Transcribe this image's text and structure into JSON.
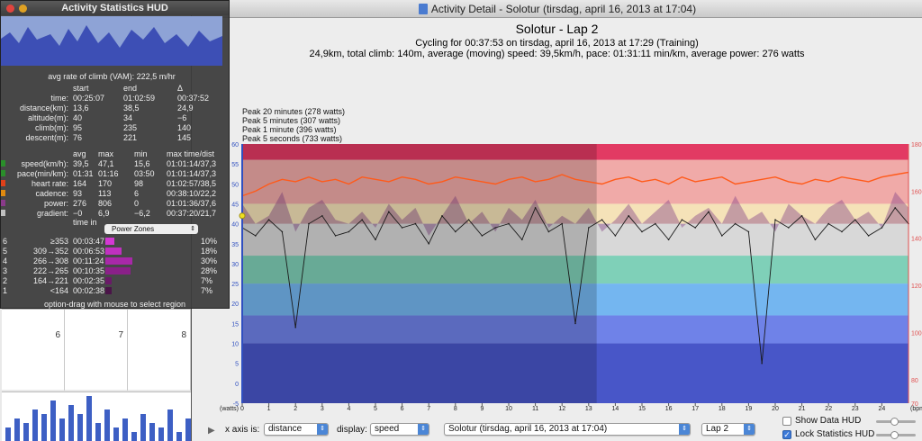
{
  "hud": {
    "title": "Activity Statistics HUD",
    "vam_label": "avg rate of climb (VAM):",
    "vam_value": "222,5 m/hr",
    "cols1": [
      "start",
      "end",
      "Δ"
    ],
    "rows1": [
      {
        "label": "time:",
        "v": [
          "00:25:07",
          "01:02:59",
          "00:37:52"
        ]
      },
      {
        "label": "distance(km):",
        "v": [
          "13,6",
          "38,5",
          "24,9"
        ]
      },
      {
        "label": "altitude(m):",
        "v": [
          "40",
          "34",
          "−6"
        ]
      },
      {
        "label": "climb(m):",
        "v": [
          "95",
          "235",
          "140"
        ]
      },
      {
        "label": "descent(m):",
        "v": [
          "76",
          "221",
          "145"
        ]
      }
    ],
    "cols2": [
      "avg",
      "max",
      "min",
      "max time/dist"
    ],
    "rows2": [
      {
        "label": "speed(km/h):",
        "color": "#2a8f2a",
        "v": [
          "39,5",
          "47,1",
          "15,6",
          "01:01:14/37,3"
        ]
      },
      {
        "label": "pace(min/km):",
        "color": "#2a8f2a",
        "v": [
          "01:31",
          "01:16",
          "03:50",
          "01:01:14/37,3"
        ]
      },
      {
        "label": "heart rate:",
        "color": "#e0401a",
        "v": [
          "164",
          "170",
          "98",
          "01:02:57/38,5"
        ]
      },
      {
        "label": "cadence:",
        "color": "#e08a10",
        "v": [
          "93",
          "113",
          "6",
          "00:38:10/22,2"
        ]
      },
      {
        "label": "power:",
        "color": "#8a3a8a",
        "v": [
          "276",
          "806",
          "0",
          "01:01:36/37,6"
        ]
      },
      {
        "label": "gradient:",
        "color": "#c0c0c0",
        "v": [
          "−0",
          "6,9",
          "−6,2",
          "00:37:20/21,7"
        ]
      }
    ],
    "zone_col": "time in",
    "zone_select": "Power Zones",
    "zones": [
      {
        "idx": "6",
        "range": "≥353",
        "time": "00:03:47",
        "pct": "10%",
        "frac": 0.1
      },
      {
        "idx": "5",
        "range": "309→352",
        "time": "00:06:53",
        "pct": "18%",
        "frac": 0.18
      },
      {
        "idx": "4",
        "range": "266→308",
        "time": "00:11:24",
        "pct": "30%",
        "frac": 0.3
      },
      {
        "idx": "3",
        "range": "222→265",
        "time": "00:10:35",
        "pct": "28%",
        "frac": 0.28
      },
      {
        "idx": "2",
        "range": "164→221",
        "time": "00:02:35",
        "pct": "7%",
        "frac": 0.07
      },
      {
        "idx": "1",
        "range": "<164",
        "time": "00:02:38",
        "pct": "7%",
        "frac": 0.07
      }
    ],
    "footer": "option-drag with mouse to select region"
  },
  "background": {
    "calendar_days": [
      "6",
      "7",
      "8"
    ],
    "week_bars": [
      0.3,
      0.5,
      0.4,
      0.7,
      0.6,
      0.9,
      0.5,
      0.8,
      0.6,
      1.0,
      0.4,
      0.7,
      0.3,
      0.5,
      0.2,
      0.6,
      0.4,
      0.3,
      0.7,
      0.2,
      0.5,
      0.3,
      0.4,
      0.2
    ]
  },
  "window": {
    "title": "Activity Detail - Solotur  (tirsdag, april 16, 2013 at 17:04)",
    "heading": "Solotur - Lap 2",
    "subheading": "Cycling for 00:37:53 on tirsdag, april 16, 2013 at 17:29 (Training)",
    "summary": "24,9km, total climb: 140m, average (moving) speed: 39,5km/h, pace: 01:31:11 min/km, average power: 276 watts",
    "peaks": [
      "Peak 20 minutes (278 watts)",
      "Peak 5 minutes (307 watts)",
      "Peak 1 minute (396 watts)",
      "Peak 5 seconds (733 watts)"
    ]
  },
  "toolbar": {
    "xaxis_label": "x axis is:",
    "xaxis_value": "distance",
    "display_label": "display:",
    "display_value": "speed",
    "activity_value": "Solotur  (tirsdag, april 16, 2013 at 17:04)",
    "lap_value": "Lap 2",
    "show_hud": "Show Data HUD",
    "show_hud_checked": false,
    "lock_hud": "Lock Statistics HUD",
    "lock_hud_checked": true
  },
  "colors": {
    "speed_line": "#1a1a1a",
    "heart_rate": "#ff5a1a",
    "power_fill": "#8a4a8a",
    "cadence_fill": "#e8c890",
    "accent": "#3d7ad8"
  },
  "chart_data": {
    "type": "line",
    "x_label_unit": "",
    "x_range": [
      0,
      25
    ],
    "x_ticks": [
      "0",
      "1",
      "2",
      "3",
      "4",
      "5",
      "6",
      "7",
      "8",
      "9",
      "10",
      "11",
      "12",
      "13",
      "14",
      "15",
      "16",
      "17",
      "18",
      "19",
      "20",
      "21",
      "22",
      "23",
      "24"
    ],
    "y_left_label": "(watts)",
    "y_left_ticks": [
      "60",
      "55",
      "50",
      "45",
      "40",
      "35",
      "30",
      "25",
      "20",
      "15",
      "10",
      "5",
      "0",
      "-5"
    ],
    "y_left_range": [
      -5,
      60
    ],
    "y_right_label": "(bpm)",
    "y_right_ticks": [
      "180",
      "160",
      "140",
      "120",
      "100",
      "80",
      "70"
    ],
    "y_right_range": [
      70,
      180
    ],
    "selection_x": [
      0,
      13.3
    ],
    "zone_bands": [
      {
        "from": 56,
        "to": 60,
        "color": "#e23a63"
      },
      {
        "from": 45,
        "to": 56,
        "color": "#f0aaa8"
      },
      {
        "from": 40,
        "to": 45,
        "color": "#f5e2b8"
      },
      {
        "from": 32,
        "to": 40,
        "color": "#d8d8d8"
      },
      {
        "from": 25,
        "to": 32,
        "color": "#7fd0b8"
      },
      {
        "from": 17,
        "to": 25,
        "color": "#74b6f0"
      },
      {
        "from": 10,
        "to": 17,
        "color": "#6f82e8"
      },
      {
        "from": -5,
        "to": 10,
        "color": "#4856c8"
      }
    ],
    "series": [
      {
        "name": "speed",
        "values": [
          39,
          37,
          41,
          38,
          14,
          40,
          42,
          37,
          38,
          41,
          36,
          43,
          39,
          40,
          35,
          42,
          38,
          41,
          37,
          39,
          40,
          36,
          44,
          38,
          40,
          15,
          39,
          41,
          37,
          42,
          38,
          40,
          36,
          41,
          39,
          43,
          37,
          40,
          38,
          5,
          41,
          39,
          42,
          36,
          40,
          38,
          41,
          37,
          39,
          44,
          40
        ]
      },
      {
        "name": "heart rate",
        "values": [
          158,
          160,
          163,
          165,
          164,
          166,
          164,
          165,
          163,
          166,
          165,
          164,
          166,
          165,
          163,
          164,
          166,
          165,
          164,
          163,
          165,
          166,
          164,
          165,
          167,
          165,
          164,
          163,
          165,
          166,
          164,
          165,
          163,
          166,
          164,
          165,
          166,
          163,
          164,
          165,
          166,
          164,
          163,
          165,
          164,
          166,
          165,
          164,
          166,
          167,
          168
        ]
      },
      {
        "name": "power",
        "values": [
          45,
          40,
          42,
          48,
          38,
          44,
          46,
          41,
          40,
          43,
          39,
          45,
          41,
          44,
          37,
          42,
          47,
          40,
          43,
          38,
          44,
          41,
          46,
          39,
          42,
          40,
          44,
          38,
          41,
          45,
          40,
          43,
          46,
          39,
          42,
          44,
          40,
          47,
          41,
          43,
          38,
          45,
          42,
          40,
          44,
          46,
          41,
          43,
          39,
          48,
          44
        ]
      }
    ]
  }
}
